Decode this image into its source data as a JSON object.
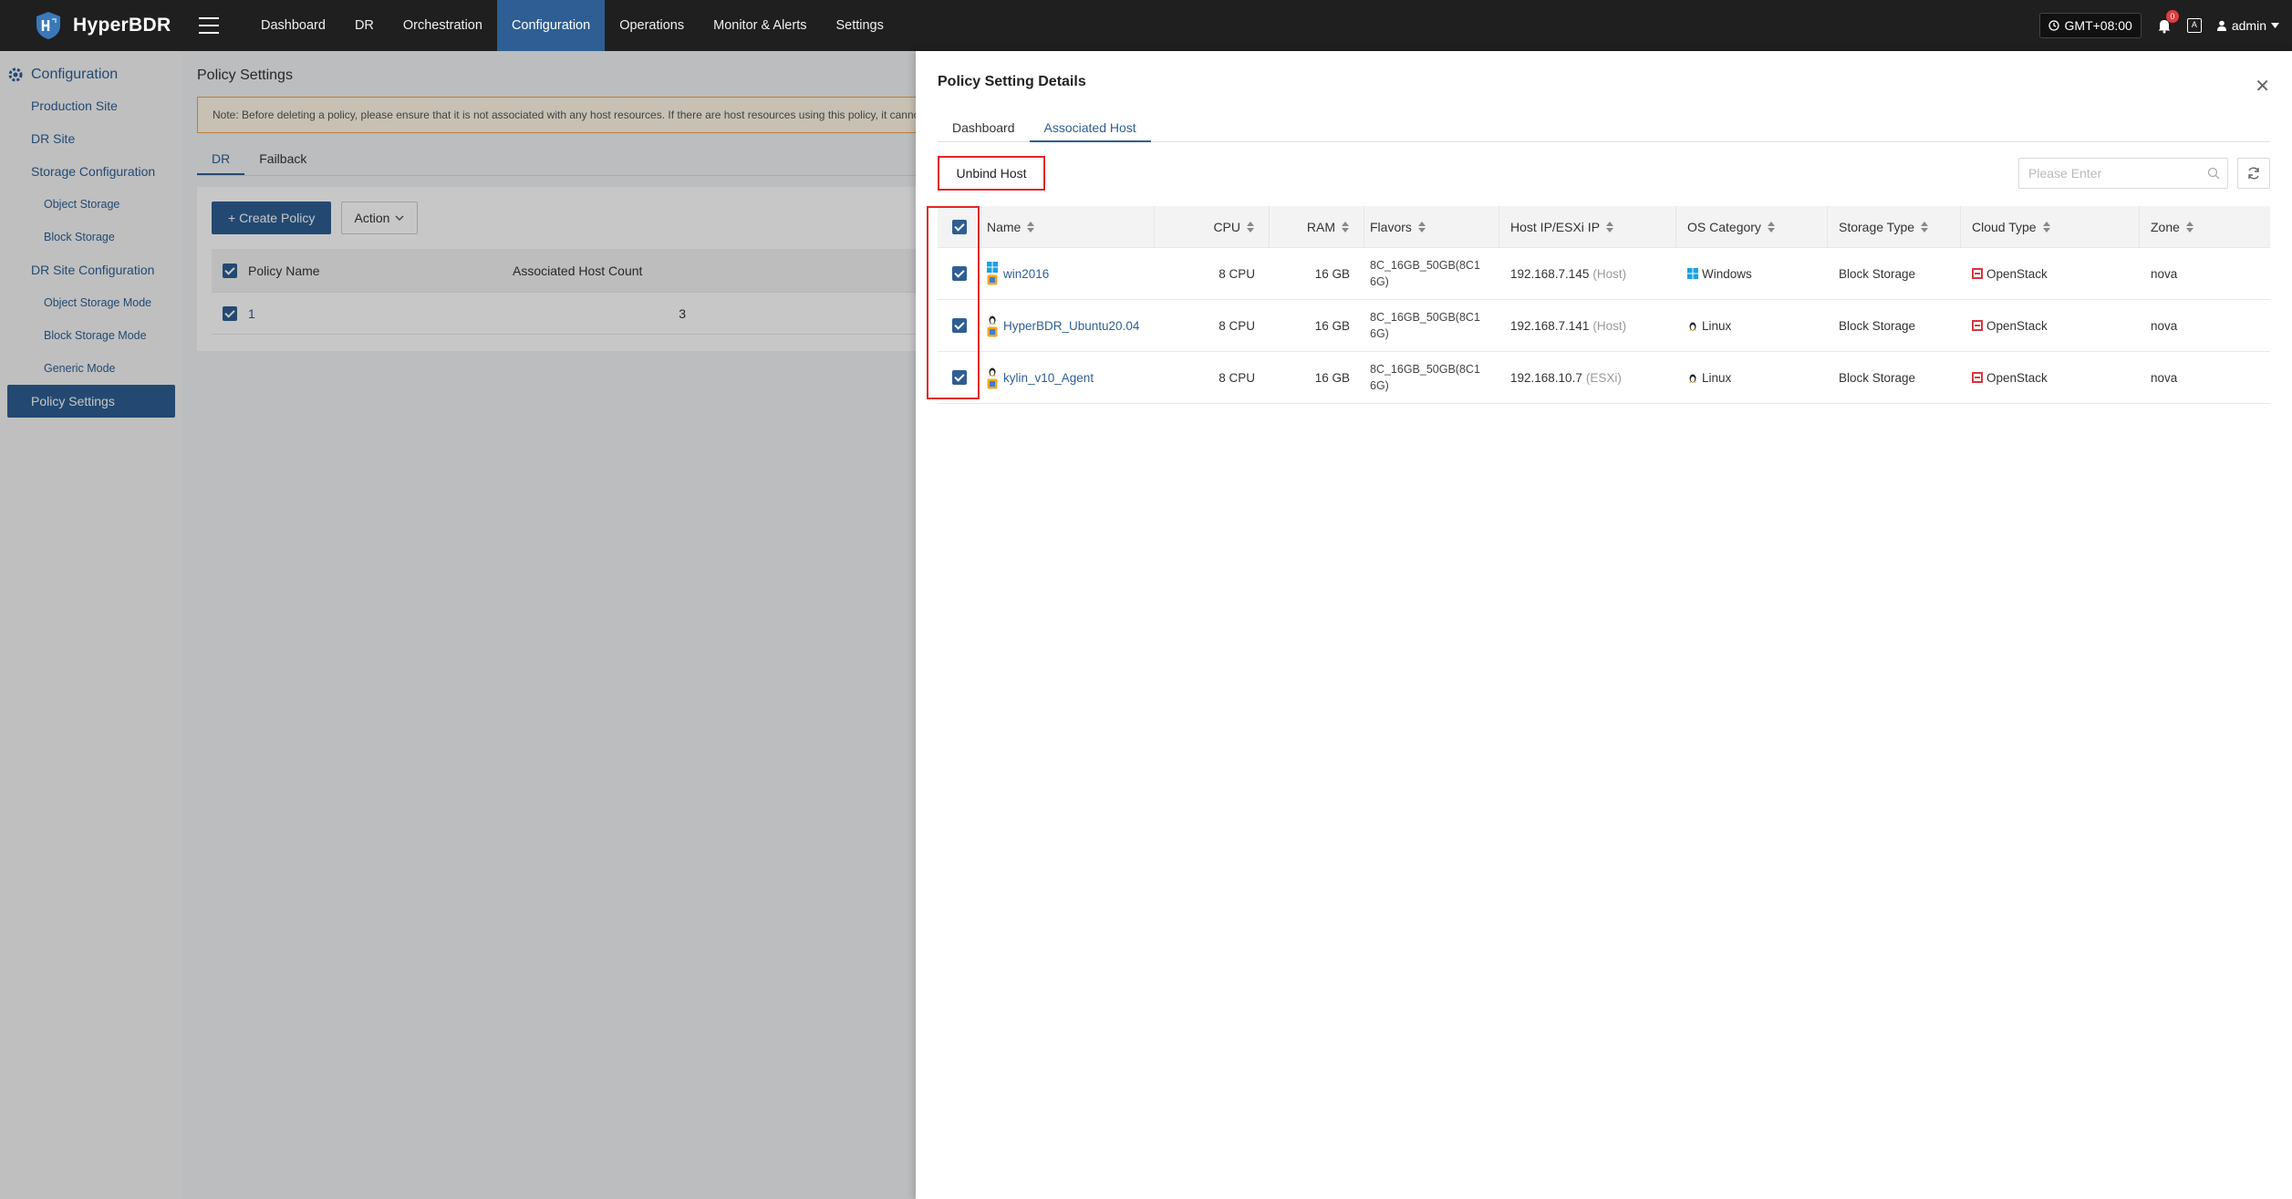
{
  "app": {
    "name": "HyperBDR"
  },
  "topnav": {
    "items": [
      "Dashboard",
      "DR",
      "Orchestration",
      "Configuration",
      "Operations",
      "Monitor & Alerts",
      "Settings"
    ],
    "active": "Configuration",
    "timezone": "GMT+08:00",
    "notification_count": "0",
    "user": "admin"
  },
  "sidebar": {
    "header": "Configuration",
    "items": [
      {
        "label": "Production Site",
        "level": 1
      },
      {
        "label": "DR Site",
        "level": 1
      },
      {
        "label": "Storage Configuration",
        "level": 1
      },
      {
        "label": "Object Storage",
        "level": 2
      },
      {
        "label": "Block Storage",
        "level": 2
      },
      {
        "label": "DR Site Configuration",
        "level": 1
      },
      {
        "label": "Object Storage Mode",
        "level": 2
      },
      {
        "label": "Block Storage Mode",
        "level": 2
      },
      {
        "label": "Generic Mode",
        "level": 2
      },
      {
        "label": "Policy Settings",
        "level": 1,
        "active": true
      }
    ]
  },
  "main": {
    "title": "Policy Settings",
    "notice": "Note: Before deleting a policy, please ensure that it is not associated with any host resources. If there are host resources using this policy, it cannot",
    "tabs": [
      "DR",
      "Failback"
    ],
    "create_button": "+ Create Policy",
    "action_button": "Action",
    "table": {
      "headers": [
        "Policy Name",
        "Associated Host Count"
      ],
      "rows": [
        {
          "name": "1",
          "count": "3"
        }
      ]
    }
  },
  "drawer": {
    "title": "Policy Setting Details",
    "tabs": [
      "Dashboard",
      "Associated Host"
    ],
    "active_tab": "Associated Host",
    "unbind_button": "Unbind Host",
    "search_placeholder": "Please Enter",
    "table": {
      "headers": [
        "Name",
        "CPU",
        "RAM",
        "Flavors",
        "Host IP/ESXi IP",
        "OS Category",
        "Storage Type",
        "Cloud Type",
        "Zone"
      ],
      "rows": [
        {
          "name": "win2016",
          "cpu": "8 CPU",
          "ram": "16 GB",
          "flavor_l1": "8C_16GB_50GB(8C1",
          "flavor_l2": "6G)",
          "ip": "192.168.7.145",
          "ip_type": "(Host)",
          "os": "Windows",
          "os_icon": "windows-icon",
          "storage": "Block Storage",
          "cloud": "OpenStack",
          "zone": "nova"
        },
        {
          "name": "HyperBDR_Ubuntu20.04",
          "cpu": "8 CPU",
          "ram": "16 GB",
          "flavor_l1": "8C_16GB_50GB(8C1",
          "flavor_l2": "6G)",
          "ip": "192.168.7.141",
          "ip_type": "(Host)",
          "os": "Linux",
          "os_icon": "linux-icon",
          "storage": "Block Storage",
          "cloud": "OpenStack",
          "zone": "nova"
        },
        {
          "name": "kylin_v10_Agent",
          "cpu": "8 CPU",
          "ram": "16 GB",
          "flavor_l1": "8C_16GB_50GB(8C1",
          "flavor_l2": "6G)",
          "ip": "192.168.10.7",
          "ip_type": "(ESXi)",
          "os": "Linux",
          "os_icon": "linux-icon",
          "storage": "Block Storage",
          "cloud": "OpenStack",
          "zone": "nova"
        }
      ]
    }
  },
  "colors": {
    "brand": "#2e5e93",
    "topbar": "#1f1f1f",
    "highlight": "#e02626"
  }
}
